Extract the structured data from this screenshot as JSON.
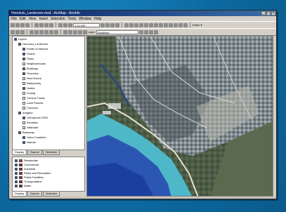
{
  "window": {
    "title": "Honolulu_Landcover.mxd - ArcMap - ArcInfo",
    "controls": [
      "_",
      "□",
      "×"
    ]
  },
  "menu": [
    "File",
    "Edit",
    "View",
    "Insert",
    "Selection",
    "Tools",
    "Window",
    "Help"
  ],
  "toolbar": {
    "scale": "1:24,000",
    "layer_label": "Layer:",
    "layer_value": "Buildings",
    "editor": "Editor ▾"
  },
  "toc": {
    "items": [
      {
        "label": "Layers",
        "checked": true,
        "indent": 0
      },
      {
        "label": "Honolulu_Landcover",
        "checked": true,
        "indent": 1
      },
      {
        "label": "Points of Interest",
        "checked": true,
        "indent": 2
      },
      {
        "label": "Roads",
        "checked": true,
        "indent": 2
      },
      {
        "label": "Parks",
        "checked": true,
        "indent": 2
      },
      {
        "label": "Neighborhoods",
        "checked": false,
        "indent": 2
      },
      {
        "label": "Buildings",
        "checked": true,
        "indent": 2
      },
      {
        "label": "Shoreline",
        "checked": true,
        "indent": 2
      },
      {
        "label": "Reef Extent",
        "checked": false,
        "indent": 2
      },
      {
        "label": "Bathymetry",
        "checked": false,
        "indent": 2
      },
      {
        "label": "Hotels",
        "checked": true,
        "indent": 2
      },
      {
        "label": "Zoning",
        "checked": false,
        "indent": 2
      },
      {
        "label": "Census Tracts",
        "checked": false,
        "indent": 2
      },
      {
        "label": "Land Parcels",
        "checked": false,
        "indent": 2
      },
      {
        "label": "Contours",
        "checked": false,
        "indent": 2
      },
      {
        "label": "Imagery",
        "checked": true,
        "indent": 1
      },
      {
        "label": "Orthophoto 2000",
        "checked": true,
        "indent": 2
      },
      {
        "label": "Elevation",
        "checked": false,
        "indent": 2
      },
      {
        "label": "Hillshade",
        "checked": false,
        "indent": 2
      },
      {
        "label": "Basemap",
        "checked": true,
        "indent": 1
      },
      {
        "label": "Oahu Coastline",
        "checked": true,
        "indent": 2
      },
      {
        "label": "Islands",
        "checked": true,
        "indent": 2
      }
    ],
    "tabs": [
      "Display",
      "Source",
      "Selection"
    ]
  },
  "legend": {
    "items": [
      {
        "label": "Residential",
        "color": "#c0392b"
      },
      {
        "label": "Commercial",
        "color": "#8e1b1b"
      },
      {
        "label": "Industrial",
        "color": "#7a3e2a"
      },
      {
        "label": "Parks and Recreation",
        "color": "#a22"
      },
      {
        "label": "Public Facilities",
        "color": "#b03030"
      },
      {
        "label": "Transportation",
        "color": "#9c2424"
      },
      {
        "label": "Water",
        "color": "#8a1c1c"
      }
    ],
    "tabs": [
      "Display",
      "Source",
      "Selection"
    ]
  },
  "colors": {
    "ocean_deep": "#1b3fa0",
    "reef": "#49b6c2",
    "urban": "#8f9aa0",
    "title_bar": "#0a246a"
  }
}
